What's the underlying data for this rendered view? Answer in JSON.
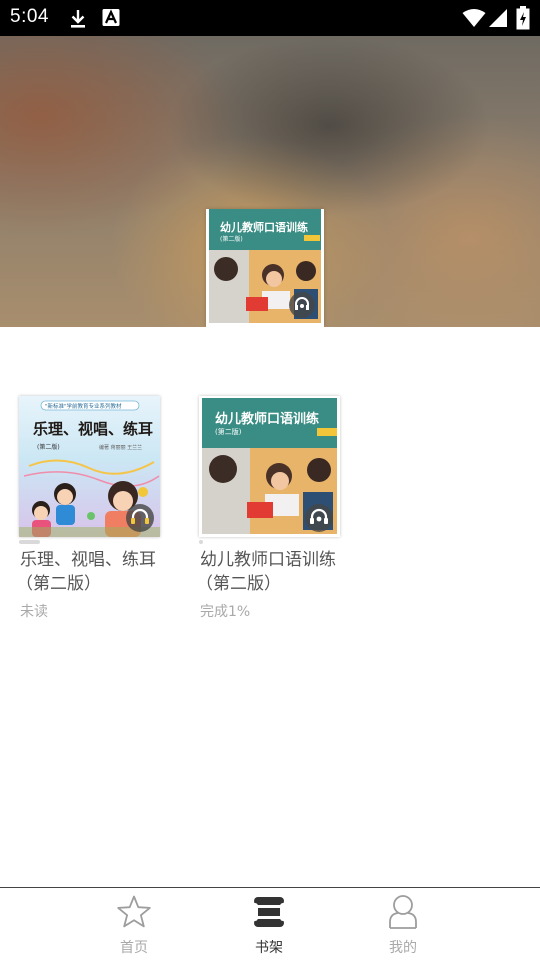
{
  "status_bar": {
    "time": "5:04",
    "left_icons": [
      "download-icon",
      "font-a-icon"
    ],
    "right_icons": [
      "wifi-icon",
      "signal-icon",
      "battery-charging-icon"
    ]
  },
  "hero": {
    "cover_book_title": "幼儿教师口语训练",
    "cover_edition": "(第二版)"
  },
  "books": [
    {
      "title_line1": "乐理、视唱、练耳",
      "title_line2": "（第二版）",
      "status": "未读",
      "cover_series": "\"新标准\"学前教育专业系列教材",
      "cover_title": "乐理、视唱、练耳",
      "cover_edition": "(第二版)",
      "cover_authors": "编著 蒋丽丽 王兰兰"
    },
    {
      "title_line1": "幼儿教师口语训练",
      "title_line2": "（第二版）",
      "status": "完成1%",
      "cover_title": "幼儿教师口语训练",
      "cover_edition": "(第二版)"
    }
  ],
  "nav": {
    "items": [
      {
        "label": "首页",
        "icon": "star-icon",
        "active": false
      },
      {
        "label": "书架",
        "icon": "bookshelf-icon",
        "active": true
      },
      {
        "label": "我的",
        "icon": "person-icon",
        "active": false
      }
    ]
  },
  "colors": {
    "accent_active": "#333333",
    "inactive": "#aaaaaa",
    "cover_teal": "#3a8d84",
    "cover_yellow": "#f3c63a"
  }
}
